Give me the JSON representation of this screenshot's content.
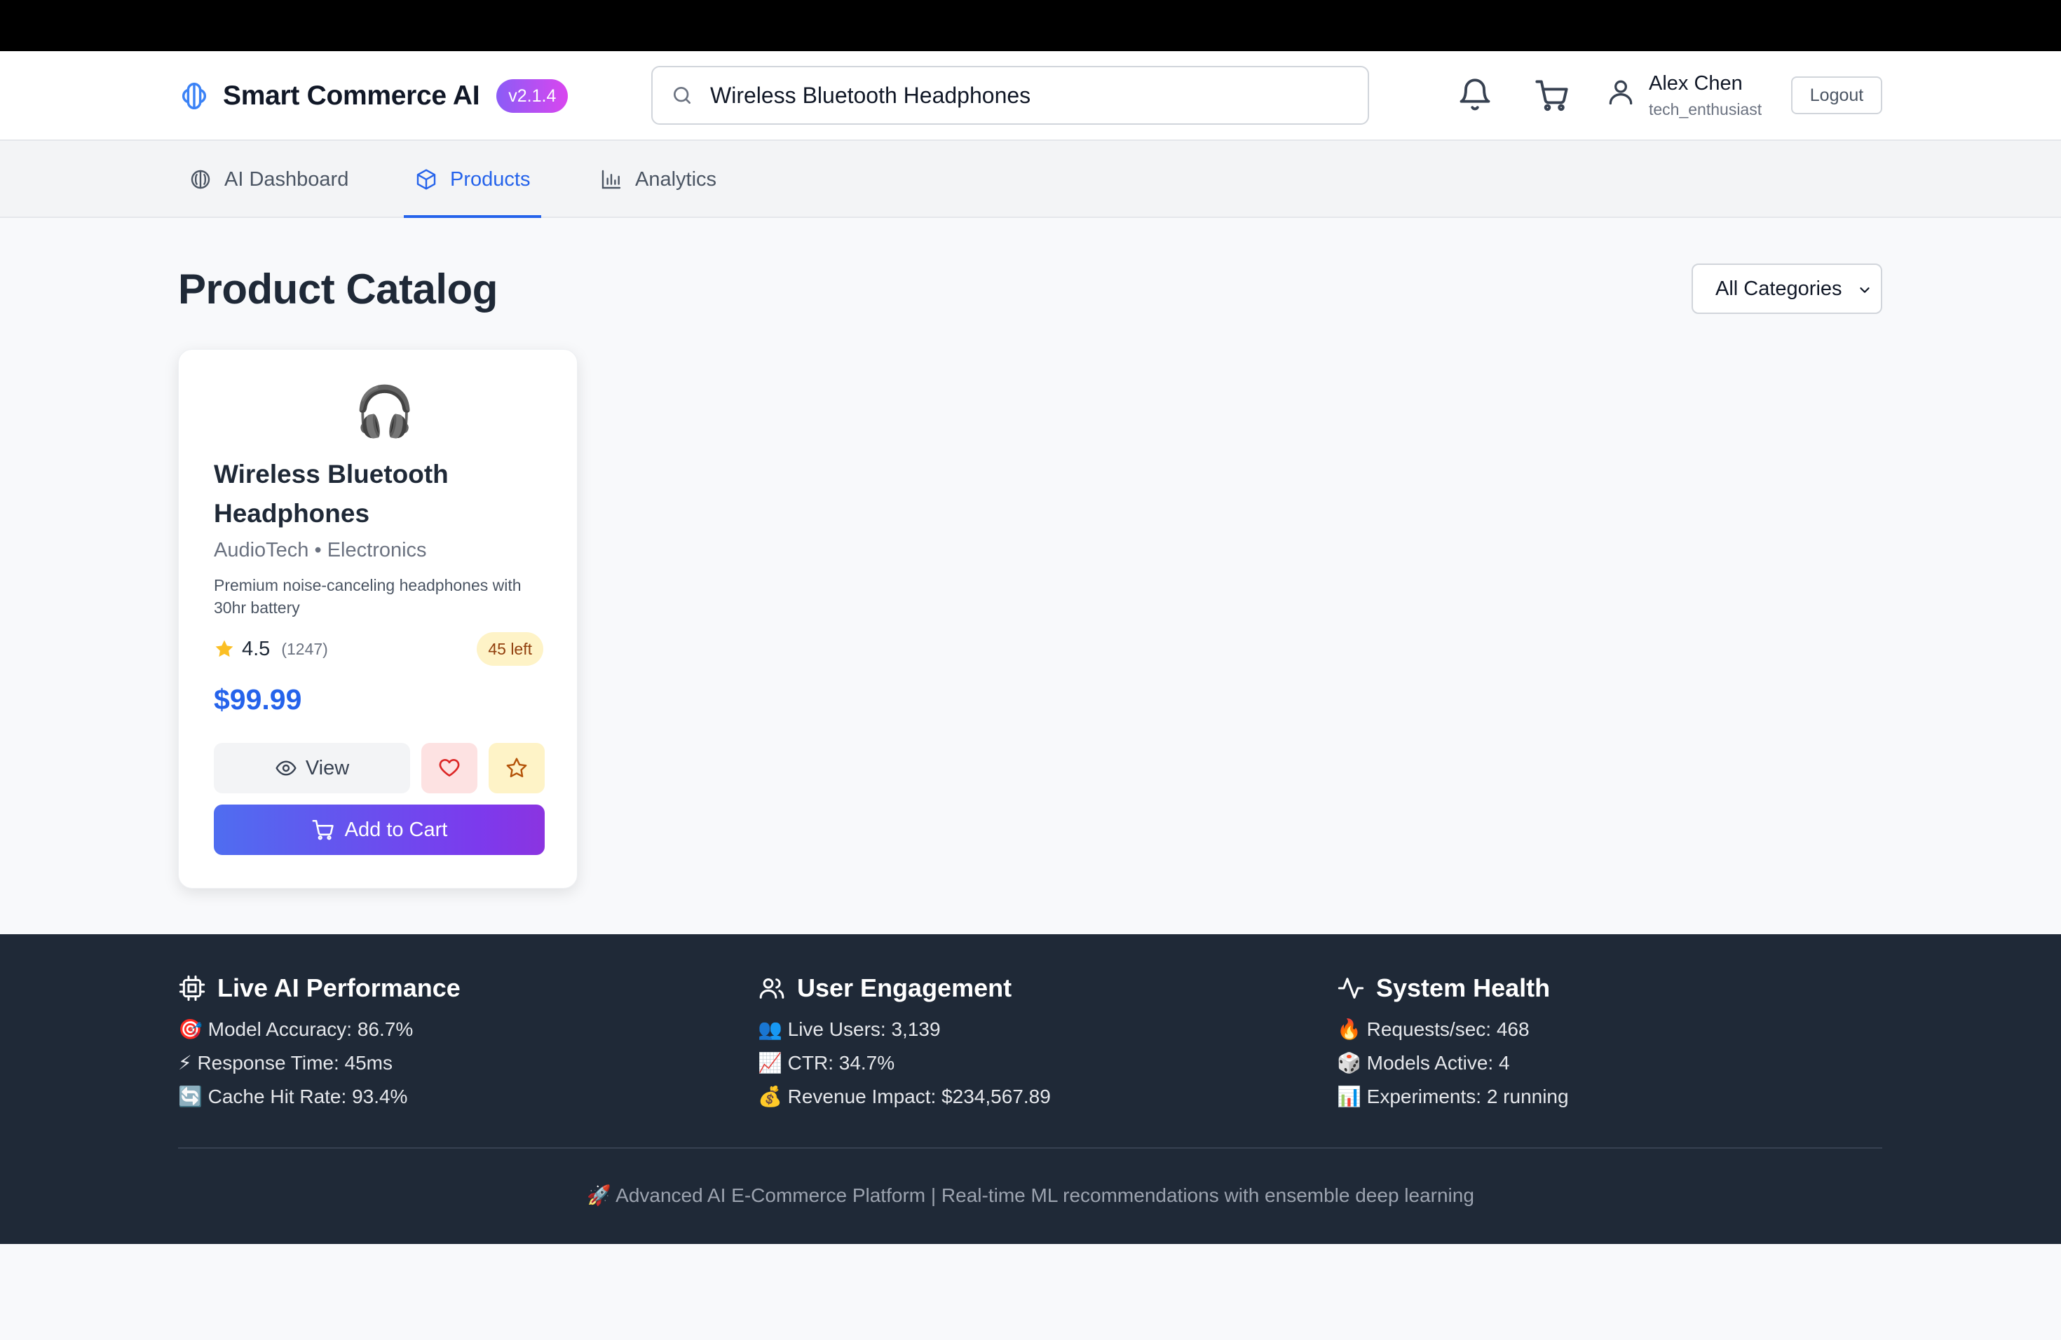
{
  "app": {
    "title": "Smart Commerce AI",
    "version": "v2.1.4",
    "accent_color": "#2563eb",
    "brand_gradient": [
      "#8b5cf6",
      "#d946ef"
    ]
  },
  "header": {
    "search": {
      "value": "Wireless Bluetooth Headphones",
      "icon": "search-icon"
    },
    "notifications_icon": "bell-icon",
    "cart_icon": "cart-icon",
    "user": {
      "name": "Alex Chen",
      "handle": "tech_enthusiast",
      "icon": "user-icon"
    },
    "logout_label": "Logout"
  },
  "nav": {
    "tabs": [
      {
        "label": "AI Dashboard",
        "icon": "brain-icon",
        "active": false
      },
      {
        "label": "Products",
        "icon": "box-icon",
        "active": true
      },
      {
        "label": "Analytics",
        "icon": "bar-chart-icon",
        "active": false
      }
    ]
  },
  "main": {
    "title": "Product Catalog",
    "category_filter": {
      "selected": "All Categories"
    },
    "products": [
      {
        "emoji": "🎧",
        "name": "Wireless Bluetooth Headphones",
        "brand": "AudioTech",
        "separator": "•",
        "category": "Electronics",
        "description": "Premium noise-canceling headphones with 30hr battery",
        "rating": "4.5",
        "review_count": "(1247)",
        "stock": "45 left",
        "price": "$99.99",
        "view_label": "View",
        "add_to_cart_label": "Add to Cart"
      }
    ]
  },
  "footer": {
    "sections": [
      {
        "title": "Live AI Performance",
        "icon": "cpu-icon",
        "lines": [
          "🎯 Model Accuracy: 86.7%",
          "⚡ Response Time: 45ms",
          "🔄 Cache Hit Rate: 93.4%"
        ]
      },
      {
        "title": "User Engagement",
        "icon": "users-icon",
        "lines": [
          "👥 Live Users: 3,139",
          "📈 CTR: 34.7%",
          "💰 Revenue Impact: $234,567.89"
        ]
      },
      {
        "title": "System Health",
        "icon": "activity-icon",
        "lines": [
          "🔥 Requests/sec: 468",
          "🎲 Models Active: 4",
          "📊 Experiments: 2 running"
        ]
      }
    ],
    "note": "🚀 Advanced AI E-Commerce Platform | Real-time ML recommendations with ensemble deep learning"
  }
}
